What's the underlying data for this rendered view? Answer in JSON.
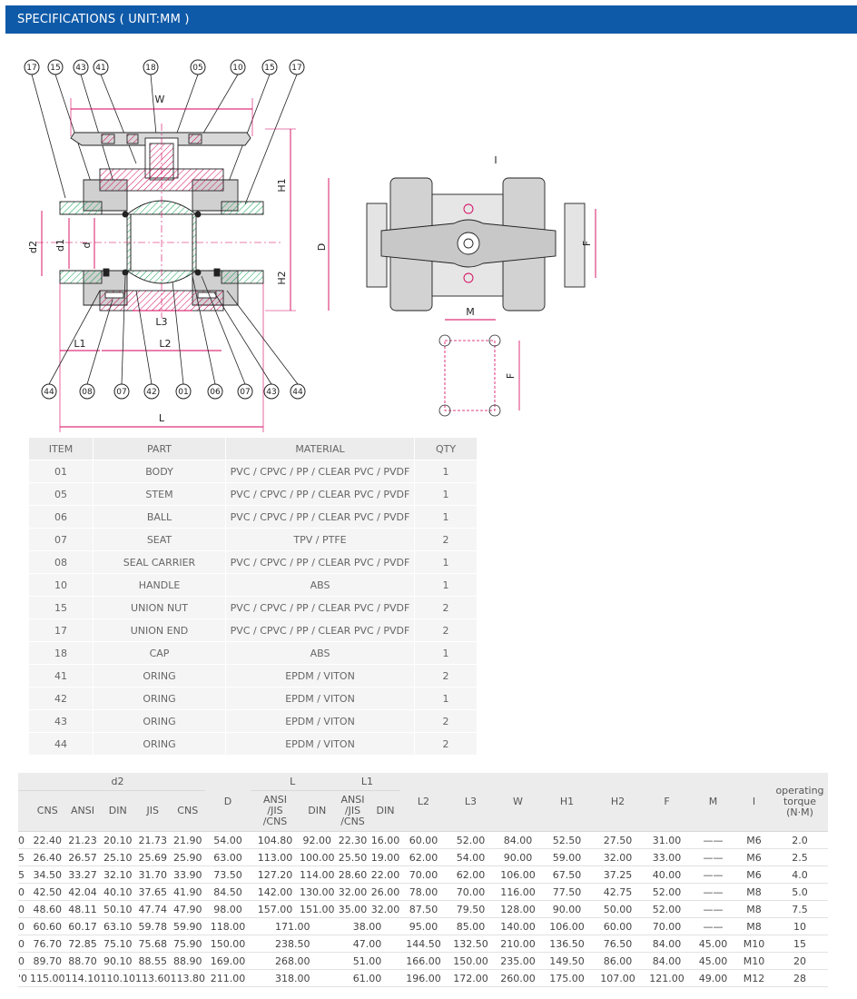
{
  "header": {
    "title": "SPECIFICATIONS ( UNIT:MM )"
  },
  "drawing": {
    "balloons_top": [
      "17",
      "15",
      "43",
      "41",
      "18",
      "05",
      "10",
      "15",
      "17"
    ],
    "balloons_bottom": [
      "44",
      "08",
      "07",
      "42",
      "01",
      "06",
      "07",
      "43",
      "44"
    ],
    "dims": {
      "w": "W",
      "h1": "H1",
      "h2": "H2",
      "d2": "d2",
      "d1": "d1",
      "d": "d",
      "l1": "L1",
      "l2": "L2",
      "l3": "L3",
      "l": "L",
      "D": "D",
      "F": "F",
      "M": "M",
      "I": "I",
      "F2": "F"
    }
  },
  "parts": {
    "headers": [
      "ITEM",
      "PART",
      "MATERIAL",
      "QTY"
    ],
    "rows": [
      [
        "01",
        "BODY",
        "PVC / CPVC / PP / CLEAR PVC / PVDF",
        "1"
      ],
      [
        "05",
        "STEM",
        "PVC / CPVC / PP / CLEAR PVC / PVDF",
        "1"
      ],
      [
        "06",
        "BALL",
        "PVC / CPVC / PP / CLEAR PVC / PVDF",
        "1"
      ],
      [
        "07",
        "SEAT",
        "TPV / PTFE",
        "2"
      ],
      [
        "08",
        "SEAL CARRIER",
        "PVC / CPVC / PP / CLEAR PVC / PVDF",
        "1"
      ],
      [
        "10",
        "HANDLE",
        "ABS",
        "1"
      ],
      [
        "15",
        "UNION NUT",
        "PVC / CPVC / PP / CLEAR PVC / PVDF",
        "2"
      ],
      [
        "17",
        "UNION END",
        "PVC / CPVC / PP / CLEAR PVC / PVDF",
        "2"
      ],
      [
        "18",
        "CAP",
        "ABS",
        "1"
      ],
      [
        "41",
        "ORING",
        "EPDM / VITON",
        "2"
      ],
      [
        "42",
        "ORING",
        "EPDM / VITON",
        "1"
      ],
      [
        "43",
        "ORING",
        "EPDM / VITON",
        "2"
      ],
      [
        "44",
        "ORING",
        "EPDM / VITON",
        "2"
      ]
    ]
  },
  "specs": {
    "group_headers": {
      "d2": "d2",
      "L": "L",
      "L1": "L1"
    },
    "sub_headers": [
      "CNS",
      "ANSI",
      "DIN",
      "JIS",
      "CNS"
    ],
    "headers": {
      "D": "D",
      "L_ansi": "ANSI\n/JIS\n/CNS",
      "L_din": "DIN",
      "L1_ansi": "ANSI\n/JIS\n/CNS",
      "L1_din": "DIN",
      "L2": "L2",
      "L3": "L3",
      "W": "W",
      "H1": "H1",
      "H2": "H2",
      "F": "F",
      "M": "M",
      "I": "I",
      "torque": "operating\ntorque\n(N·M)"
    },
    "rows": [
      [
        "0",
        "22.40",
        "21.23",
        "20.10",
        "21.73",
        "21.90",
        "54.00",
        "104.80",
        "92.00",
        "22.30",
        "16.00",
        "60.00",
        "52.00",
        "84.00",
        "52.50",
        "27.50",
        "31.00",
        "——",
        "M6",
        "2.0"
      ],
      [
        "5",
        "26.40",
        "26.57",
        "25.10",
        "25.69",
        "25.90",
        "63.00",
        "113.00",
        "100.00",
        "25.50",
        "19.00",
        "62.00",
        "54.00",
        "90.00",
        "59.00",
        "32.00",
        "33.00",
        "——",
        "M6",
        "2.5"
      ],
      [
        "5",
        "34.50",
        "33.27",
        "32.10",
        "31.70",
        "33.90",
        "73.50",
        "127.20",
        "114.00",
        "28.60",
        "22.00",
        "70.00",
        "62.00",
        "106.00",
        "67.50",
        "37.25",
        "40.00",
        "——",
        "M6",
        "4.0"
      ],
      [
        "0",
        "42.50",
        "42.04",
        "40.10",
        "37.65",
        "41.90",
        "84.50",
        "142.00",
        "130.00",
        "32.00",
        "26.00",
        "78.00",
        "70.00",
        "116.00",
        "77.50",
        "42.75",
        "52.00",
        "——",
        "M8",
        "5.0"
      ],
      [
        "0",
        "48.60",
        "48.11",
        "50.10",
        "47.74",
        "47.90",
        "98.00",
        "157.00",
        "151.00",
        "35.00",
        "32.00",
        "87.50",
        "79.50",
        "128.00",
        "90.00",
        "50.00",
        "52.00",
        "——",
        "M8",
        "7.5"
      ],
      [
        "0",
        "60.60",
        "60.17",
        "63.10",
        "59.78",
        "59.90",
        "118.00",
        "171.00",
        null,
        "38.00",
        null,
        "95.00",
        "85.00",
        "140.00",
        "106.00",
        "60.00",
        "70.00",
        "——",
        "M8",
        "10"
      ],
      [
        "0",
        "76.70",
        "72.85",
        "75.10",
        "75.68",
        "75.90",
        "150.00",
        "238.50",
        null,
        "47.00",
        null,
        "144.50",
        "132.50",
        "210.00",
        "136.50",
        "76.50",
        "84.00",
        "45.00",
        "M10",
        "15"
      ],
      [
        "0",
        "89.70",
        "88.70",
        "90.10",
        "88.55",
        "88.90",
        "169.00",
        "268.00",
        null,
        "51.00",
        null,
        "166.00",
        "150.00",
        "235.00",
        "149.50",
        "86.00",
        "84.00",
        "45.00",
        "M10",
        "20"
      ],
      [
        "'0",
        "115.00",
        "114.10",
        "110.10",
        "113.60",
        "113.80",
        "211.00",
        "318.00",
        null,
        "61.00",
        null,
        "196.00",
        "172.00",
        "260.00",
        "175.00",
        "107.00",
        "121.00",
        "49.00",
        "M12",
        "28"
      ]
    ]
  },
  "colors": {
    "header_bg": "#0f5aa8",
    "line": "#222222",
    "dim": "#d4005a",
    "hatch": "#0aa050"
  }
}
